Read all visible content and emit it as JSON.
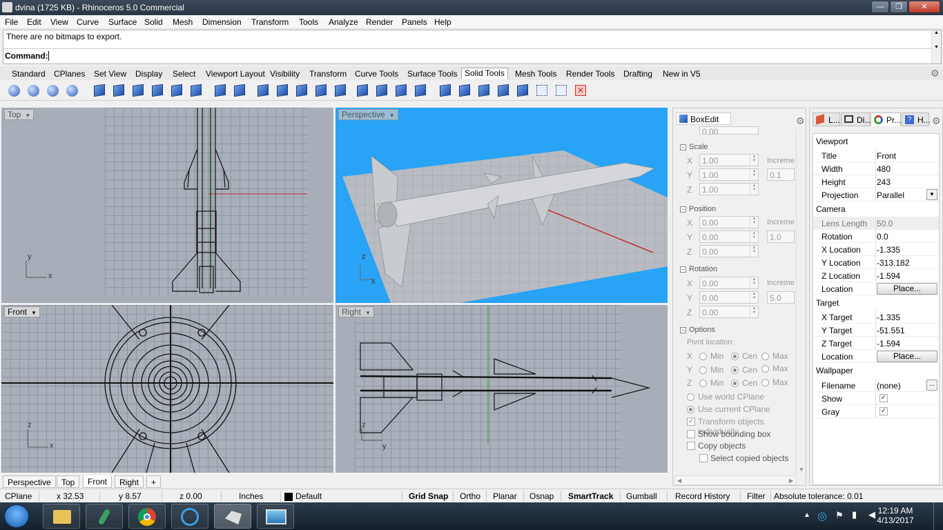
{
  "window": {
    "title": "dvina (1725 KB) - Rhinoceros 5.0 Commercial",
    "controls": {
      "minimize": "—",
      "maximize": "❐",
      "close": "✕"
    }
  },
  "menu": [
    "File",
    "Edit",
    "View",
    "Curve",
    "Surface",
    "Solid",
    "Mesh",
    "Dimension",
    "Transform",
    "Tools",
    "Analyze",
    "Render",
    "Panels",
    "Help"
  ],
  "command": {
    "history": "There are no bitmaps to export.",
    "prompt": "Command:",
    "value": ""
  },
  "toolbar_tabs": [
    "Standard",
    "CPlanes",
    "Set View",
    "Display",
    "Select",
    "Viewport Layout",
    "Visibility",
    "Transform",
    "Curve Tools",
    "Surface Tools",
    "Solid Tools",
    "Mesh Tools",
    "Render Tools",
    "Drafting",
    "New in V5"
  ],
  "toolbar_active": "Solid Tools",
  "viewports": {
    "top": {
      "label": "Top",
      "axis_x": "x",
      "axis_y": "y"
    },
    "perspective": {
      "label": "Perspective",
      "axis_x": "x",
      "axis_y": "z"
    },
    "front": {
      "label": "Front",
      "axis_x": "x",
      "axis_y": "z"
    },
    "right": {
      "label": "Right",
      "axis_x": "y",
      "axis_y": "z"
    }
  },
  "viewport_tabs": [
    "Perspective",
    "Top",
    "Front",
    "Right"
  ],
  "viewport_tab_active": "Front",
  "viewport_tab_add": "+",
  "boxedit": {
    "title": "BoxEdit",
    "z_top_value": "0.00",
    "scale": {
      "title": "Scale",
      "x": "1.00",
      "y": "1.00",
      "z": "1.00",
      "increment_label": "Increme",
      "increment": "0.1"
    },
    "position": {
      "title": "Position",
      "x": "0.00",
      "y": "0.00",
      "z": "0.00",
      "increment_label": "Increme",
      "increment": "1.0"
    },
    "rotation": {
      "title": "Rotation",
      "x": "0.00",
      "y": "0.00",
      "z": "0.00",
      "increment_label": "Increme",
      "increment": "5.0"
    },
    "axis_labels": {
      "x": "X",
      "y": "Y",
      "z": "Z"
    },
    "options": {
      "title": "Options",
      "pivot_label": "Pivot location:",
      "min": "Min",
      "cen": "Cen",
      "max": "Max",
      "use_world_cplane": "Use world CPlane",
      "use_current_cplane": "Use current CPlane",
      "transform_individually": "Transform objects individually",
      "show_bounding_box": "Show bounding box",
      "copy_objects": "Copy objects",
      "select_copied": "Select copied objects"
    }
  },
  "properties": {
    "tabs": [
      "L...",
      "Di...",
      "Pr...",
      "H..."
    ],
    "viewport_group": "Viewport",
    "title_label": "Title",
    "title": "Front",
    "width_label": "Width",
    "width": "480",
    "height_label": "Height",
    "height": "243",
    "projection_label": "Projection",
    "projection": "Parallel",
    "camera_group": "Camera",
    "lens_label": "Lens Length",
    "lens": "50.0",
    "rotation_label": "Rotation",
    "rotation": "0.0",
    "xloc_label": "X Location",
    "xloc": "-1.335",
    "yloc_label": "Y Location",
    "yloc": "-313.182",
    "zloc_label": "Z Location",
    "zloc": "-1.594",
    "location_label": "Location",
    "place_button": "Place...",
    "target_group": "Target",
    "xt_label": "X Target",
    "xt": "-1.335",
    "yt_label": "Y Target",
    "yt": "-51.551",
    "zt_label": "Z Target",
    "zt": "-1.594",
    "tlocation_label": "Location",
    "wallpaper_group": "Wallpaper",
    "filename_label": "Filename",
    "filename": "(none)",
    "browse": "...",
    "show_label": "Show",
    "gray_label": "Gray"
  },
  "status": {
    "cplane": "CPlane",
    "x": "x 32.53",
    "y": "y 8.57",
    "z": "z 0.00",
    "units": "Inches",
    "layer": "Default",
    "grid_snap": "Grid Snap",
    "ortho": "Ortho",
    "planar": "Planar",
    "osnap": "Osnap",
    "smarttrack": "SmartTrack",
    "gumball": "Gumball",
    "record_history": "Record History",
    "filter": "Filter",
    "tolerance": "Absolute tolerance: 0.01"
  },
  "taskbar": {
    "time": "12:19 AM",
    "date": "4/13/2017"
  },
  "colors": {
    "perspective_bg": "#29a3f5",
    "viewport_bg": "#a7aeb7",
    "accent": "#c0392b"
  }
}
